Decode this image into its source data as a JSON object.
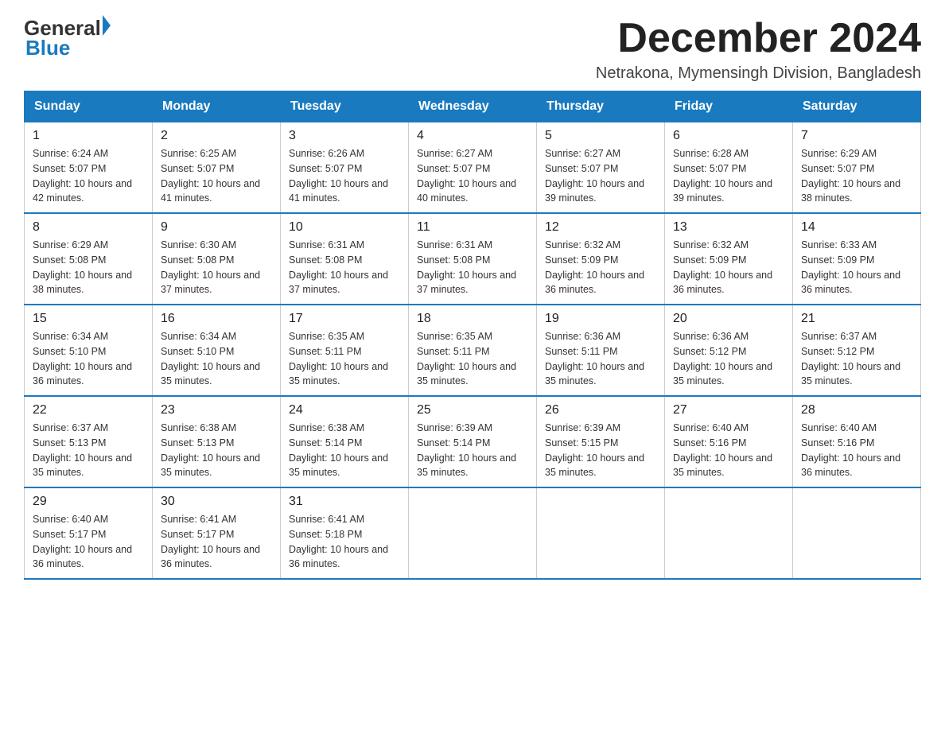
{
  "header": {
    "logo_general": "General",
    "logo_blue": "Blue",
    "title": "December 2024",
    "subtitle": "Netrakona, Mymensingh Division, Bangladesh"
  },
  "days_of_week": [
    "Sunday",
    "Monday",
    "Tuesday",
    "Wednesday",
    "Thursday",
    "Friday",
    "Saturday"
  ],
  "weeks": [
    [
      {
        "day": "1",
        "sunrise": "6:24 AM",
        "sunset": "5:07 PM",
        "daylight": "10 hours and 42 minutes."
      },
      {
        "day": "2",
        "sunrise": "6:25 AM",
        "sunset": "5:07 PM",
        "daylight": "10 hours and 41 minutes."
      },
      {
        "day": "3",
        "sunrise": "6:26 AM",
        "sunset": "5:07 PM",
        "daylight": "10 hours and 41 minutes."
      },
      {
        "day": "4",
        "sunrise": "6:27 AM",
        "sunset": "5:07 PM",
        "daylight": "10 hours and 40 minutes."
      },
      {
        "day": "5",
        "sunrise": "6:27 AM",
        "sunset": "5:07 PM",
        "daylight": "10 hours and 39 minutes."
      },
      {
        "day": "6",
        "sunrise": "6:28 AM",
        "sunset": "5:07 PM",
        "daylight": "10 hours and 39 minutes."
      },
      {
        "day": "7",
        "sunrise": "6:29 AM",
        "sunset": "5:07 PM",
        "daylight": "10 hours and 38 minutes."
      }
    ],
    [
      {
        "day": "8",
        "sunrise": "6:29 AM",
        "sunset": "5:08 PM",
        "daylight": "10 hours and 38 minutes."
      },
      {
        "day": "9",
        "sunrise": "6:30 AM",
        "sunset": "5:08 PM",
        "daylight": "10 hours and 37 minutes."
      },
      {
        "day": "10",
        "sunrise": "6:31 AM",
        "sunset": "5:08 PM",
        "daylight": "10 hours and 37 minutes."
      },
      {
        "day": "11",
        "sunrise": "6:31 AM",
        "sunset": "5:08 PM",
        "daylight": "10 hours and 37 minutes."
      },
      {
        "day": "12",
        "sunrise": "6:32 AM",
        "sunset": "5:09 PM",
        "daylight": "10 hours and 36 minutes."
      },
      {
        "day": "13",
        "sunrise": "6:32 AM",
        "sunset": "5:09 PM",
        "daylight": "10 hours and 36 minutes."
      },
      {
        "day": "14",
        "sunrise": "6:33 AM",
        "sunset": "5:09 PM",
        "daylight": "10 hours and 36 minutes."
      }
    ],
    [
      {
        "day": "15",
        "sunrise": "6:34 AM",
        "sunset": "5:10 PM",
        "daylight": "10 hours and 36 minutes."
      },
      {
        "day": "16",
        "sunrise": "6:34 AM",
        "sunset": "5:10 PM",
        "daylight": "10 hours and 35 minutes."
      },
      {
        "day": "17",
        "sunrise": "6:35 AM",
        "sunset": "5:11 PM",
        "daylight": "10 hours and 35 minutes."
      },
      {
        "day": "18",
        "sunrise": "6:35 AM",
        "sunset": "5:11 PM",
        "daylight": "10 hours and 35 minutes."
      },
      {
        "day": "19",
        "sunrise": "6:36 AM",
        "sunset": "5:11 PM",
        "daylight": "10 hours and 35 minutes."
      },
      {
        "day": "20",
        "sunrise": "6:36 AM",
        "sunset": "5:12 PM",
        "daylight": "10 hours and 35 minutes."
      },
      {
        "day": "21",
        "sunrise": "6:37 AM",
        "sunset": "5:12 PM",
        "daylight": "10 hours and 35 minutes."
      }
    ],
    [
      {
        "day": "22",
        "sunrise": "6:37 AM",
        "sunset": "5:13 PM",
        "daylight": "10 hours and 35 minutes."
      },
      {
        "day": "23",
        "sunrise": "6:38 AM",
        "sunset": "5:13 PM",
        "daylight": "10 hours and 35 minutes."
      },
      {
        "day": "24",
        "sunrise": "6:38 AM",
        "sunset": "5:14 PM",
        "daylight": "10 hours and 35 minutes."
      },
      {
        "day": "25",
        "sunrise": "6:39 AM",
        "sunset": "5:14 PM",
        "daylight": "10 hours and 35 minutes."
      },
      {
        "day": "26",
        "sunrise": "6:39 AM",
        "sunset": "5:15 PM",
        "daylight": "10 hours and 35 minutes."
      },
      {
        "day": "27",
        "sunrise": "6:40 AM",
        "sunset": "5:16 PM",
        "daylight": "10 hours and 35 minutes."
      },
      {
        "day": "28",
        "sunrise": "6:40 AM",
        "sunset": "5:16 PM",
        "daylight": "10 hours and 36 minutes."
      }
    ],
    [
      {
        "day": "29",
        "sunrise": "6:40 AM",
        "sunset": "5:17 PM",
        "daylight": "10 hours and 36 minutes."
      },
      {
        "day": "30",
        "sunrise": "6:41 AM",
        "sunset": "5:17 PM",
        "daylight": "10 hours and 36 minutes."
      },
      {
        "day": "31",
        "sunrise": "6:41 AM",
        "sunset": "5:18 PM",
        "daylight": "10 hours and 36 minutes."
      },
      null,
      null,
      null,
      null
    ]
  ]
}
